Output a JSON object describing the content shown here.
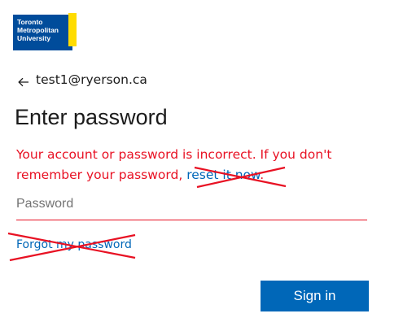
{
  "logo": {
    "lines": [
      "Toronto",
      "Metropolitan",
      "University"
    ],
    "colors": {
      "primary": "#004c9b",
      "accent": "#ffdc00"
    }
  },
  "account": {
    "email": "test1@ryerson.ca",
    "back_icon": "back-arrow-icon"
  },
  "page": {
    "title": "Enter password"
  },
  "error": {
    "message_prefix": "Your account or password is incorrect. If you don't remember your password, ",
    "reset_link": "reset it now",
    "message_suffix": ".",
    "color": "#e81123"
  },
  "password": {
    "placeholder": "Password",
    "value": ""
  },
  "links": {
    "forgot": "Forgot my password"
  },
  "actions": {
    "sign_in_label": "Sign in",
    "accent": "#0067b8"
  },
  "annotations": {
    "color": "#e81123",
    "marks": [
      "cross-out-reset-link",
      "cross-out-forgot-link"
    ]
  }
}
